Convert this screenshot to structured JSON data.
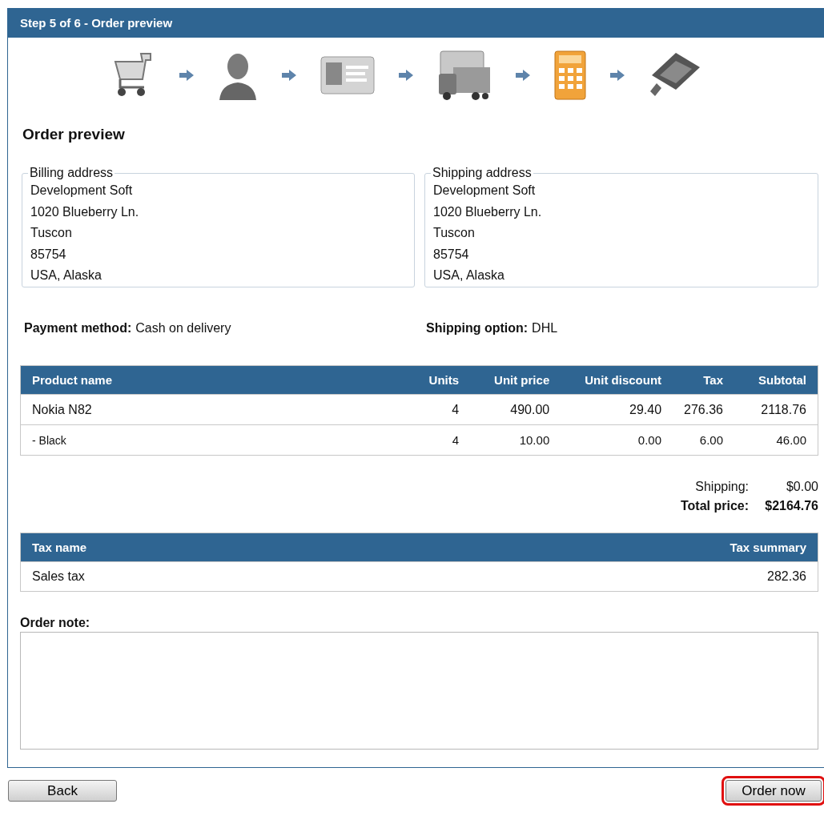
{
  "header": {
    "title": "Step 5 of 6 - Order preview"
  },
  "heading": "Order preview",
  "addresses": [
    {
      "legend": "Billing address",
      "lines": [
        "Development Soft",
        "1020 Blueberry Ln.",
        "Tuscon",
        "85754",
        "USA, Alaska"
      ]
    },
    {
      "legend": "Shipping address",
      "lines": [
        "Development Soft",
        "1020 Blueberry Ln.",
        "Tuscon",
        "85754",
        "USA, Alaska"
      ]
    }
  ],
  "options": [
    {
      "label": "Payment method:",
      "value": "Cash on delivery"
    },
    {
      "label": "Shipping option:",
      "value": "DHL"
    }
  ],
  "products": {
    "columns": [
      "Product name",
      "Units",
      "Unit price",
      "Unit discount",
      "Tax",
      "Subtotal"
    ],
    "rows": [
      {
        "kind": "product",
        "cells": [
          "Nokia N82",
          "4",
          "490.00",
          "29.40",
          "276.36",
          "2118.76"
        ]
      },
      {
        "kind": "option",
        "cells": [
          "- Black",
          "4",
          "10.00",
          "0.00",
          "6.00",
          "46.00"
        ]
      }
    ]
  },
  "totals": [
    {
      "label": "Shipping:",
      "value": "$0.00",
      "bold": false
    },
    {
      "label": "Total price:",
      "value": "$2164.76",
      "bold": true
    }
  ],
  "taxes": {
    "columns": [
      "Tax name",
      "Tax summary"
    ],
    "rows": [
      [
        "Sales tax",
        "282.36"
      ]
    ]
  },
  "note": {
    "label": "Order note:"
  },
  "buttons": [
    {
      "label": "Back",
      "highlighted": false
    },
    {
      "label": "Order now",
      "highlighted": true
    }
  ]
}
